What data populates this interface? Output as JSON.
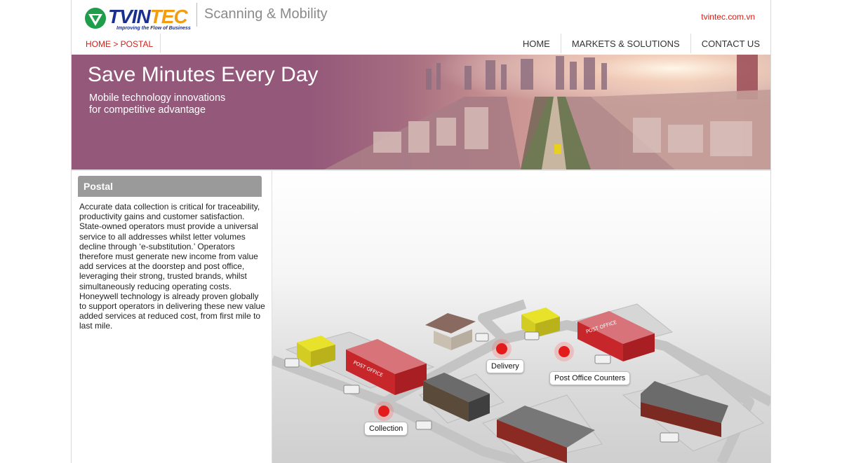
{
  "header": {
    "logo_text_a": "TVIN",
    "logo_text_b": "TEC",
    "logo_tagline": "Improving the Flow of Business",
    "subtitle": "Scanning & Mobility",
    "domain": "tvintec.com.vn",
    "breadcrumb": "HOME > POSTAL"
  },
  "nav": {
    "items": [
      "HOME",
      "MARKETS & SOLUTIONS",
      "CONTACT US"
    ]
  },
  "banner": {
    "title": "Save Minutes Every Day",
    "subtitle_line1": "Mobile technology innovations",
    "subtitle_line2": "for competitive advantage"
  },
  "sidebar": {
    "heading": "Postal",
    "body": "Accurate data collection is critical for traceability, productivity gains and customer satisfaction. State-owned operators must provide a universal service to all addresses whilst letter volumes decline through ‘e-substitution.’ Operators therefore must generate new income from value add services at the doorstep and post office, leveraging their strong, trusted brands, whilst simultaneously reducing operating costs. Honeywell technology is already proven globally to support operators in delivering these new value added services at reduced cost, from first mile to last mile."
  },
  "illustration": {
    "callouts": [
      "Delivery",
      "Post Office Counters",
      "Collection"
    ],
    "building_sign": "POST OFFICE"
  },
  "colors": {
    "accent_red": "#d0201a",
    "banner_purple": "#94587a",
    "sidebar_header": "#9a9a9a"
  }
}
